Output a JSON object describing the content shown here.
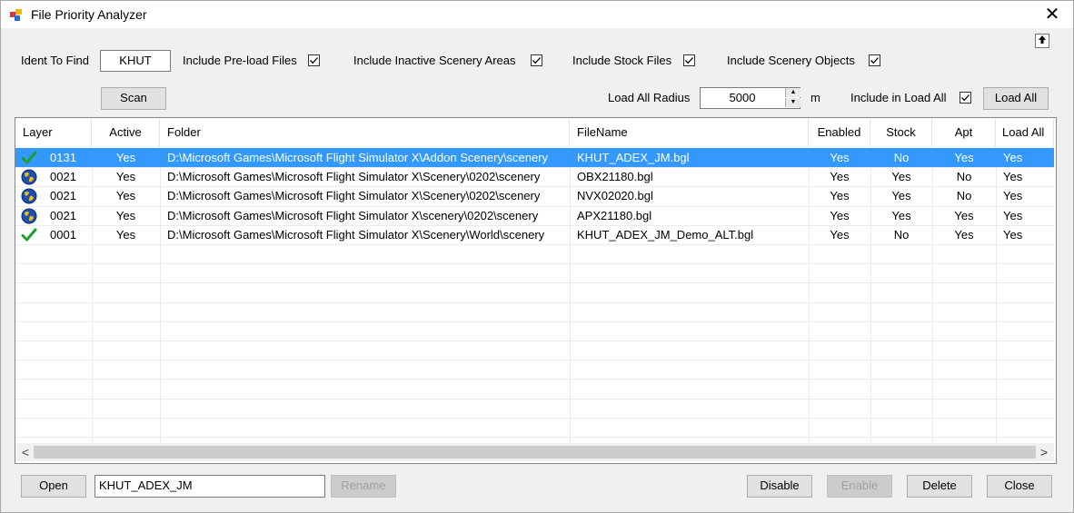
{
  "window": {
    "title": "File Priority Analyzer",
    "close_glyph": "✕",
    "app_icon": "app-icon",
    "pin_glyph": "🡅"
  },
  "options": {
    "ident_label": "Ident To Find",
    "ident_value": "KHUT",
    "preload_label": "Include Pre-load Files",
    "preload_checked": true,
    "inactive_label": "Include Inactive Scenery Areas",
    "inactive_checked": true,
    "stock_label": "Include Stock Files",
    "stock_checked": true,
    "objects_label": "Include Scenery Objects",
    "objects_checked": true,
    "scan_label": "Scan",
    "radius_label": "Load All Radius",
    "radius_value": "5000",
    "radius_unit": "m",
    "include_load_all_label": "Include in Load All",
    "include_load_all_checked": true,
    "load_all_label": "Load All"
  },
  "grid": {
    "columns": [
      {
        "key": "layer",
        "label": "Layer"
      },
      {
        "key": "active",
        "label": "Active"
      },
      {
        "key": "folder",
        "label": "Folder"
      },
      {
        "key": "filename",
        "label": "FileName"
      },
      {
        "key": "enabled",
        "label": "Enabled"
      },
      {
        "key": "stock",
        "label": "Stock"
      },
      {
        "key": "apt",
        "label": "Apt"
      },
      {
        "key": "loadall",
        "label": "Load All"
      }
    ],
    "rows": [
      {
        "icon": "check-icon",
        "layer": "0131",
        "active": "Yes",
        "folder": "D:\\Microsoft Games\\Microsoft Flight Simulator X\\Addon Scenery\\scenery",
        "filename": "KHUT_ADEX_JM.bgl",
        "enabled": "Yes",
        "stock": "No",
        "apt": "Yes",
        "loadall": "Yes",
        "selected": true
      },
      {
        "icon": "globe-icon",
        "layer": "0021",
        "active": "Yes",
        "folder": "D:\\Microsoft Games\\Microsoft Flight Simulator X\\Scenery\\0202\\scenery",
        "filename": "OBX21180.bgl",
        "enabled": "Yes",
        "stock": "Yes",
        "apt": "No",
        "loadall": "Yes",
        "selected": false
      },
      {
        "icon": "globe-icon",
        "layer": "0021",
        "active": "Yes",
        "folder": "D:\\Microsoft Games\\Microsoft Flight Simulator X\\Scenery\\0202\\scenery",
        "filename": "NVX02020.bgl",
        "enabled": "Yes",
        "stock": "Yes",
        "apt": "No",
        "loadall": "Yes",
        "selected": false
      },
      {
        "icon": "globe-icon",
        "layer": "0021",
        "active": "Yes",
        "folder": "D:\\Microsoft Games\\Microsoft Flight Simulator X\\scenery\\0202\\scenery",
        "filename": "APX21180.bgl",
        "enabled": "Yes",
        "stock": "Yes",
        "apt": "Yes",
        "loadall": "Yes",
        "selected": false
      },
      {
        "icon": "check-icon",
        "layer": "0001",
        "active": "Yes",
        "folder": "D:\\Microsoft Games\\Microsoft Flight Simulator X\\Scenery\\World\\scenery",
        "filename": "KHUT_ADEX_JM_Demo_ALT.bgl",
        "enabled": "Yes",
        "stock": "No",
        "apt": "Yes",
        "loadall": "Yes",
        "selected": false
      }
    ],
    "scroll_left": "<",
    "scroll_right": ">"
  },
  "footer": {
    "open_label": "Open",
    "name_value": "KHUT_ADEX_JM",
    "rename_label": "Rename",
    "disable_label": "Disable",
    "enable_label": "Enable",
    "delete_label": "Delete",
    "close_label": "Close"
  },
  "colors": {
    "selection": "#3399ff",
    "check_green": "#1e9e2a",
    "globe_blue": "#1f4fb5",
    "globe_land": "#f2c200"
  }
}
